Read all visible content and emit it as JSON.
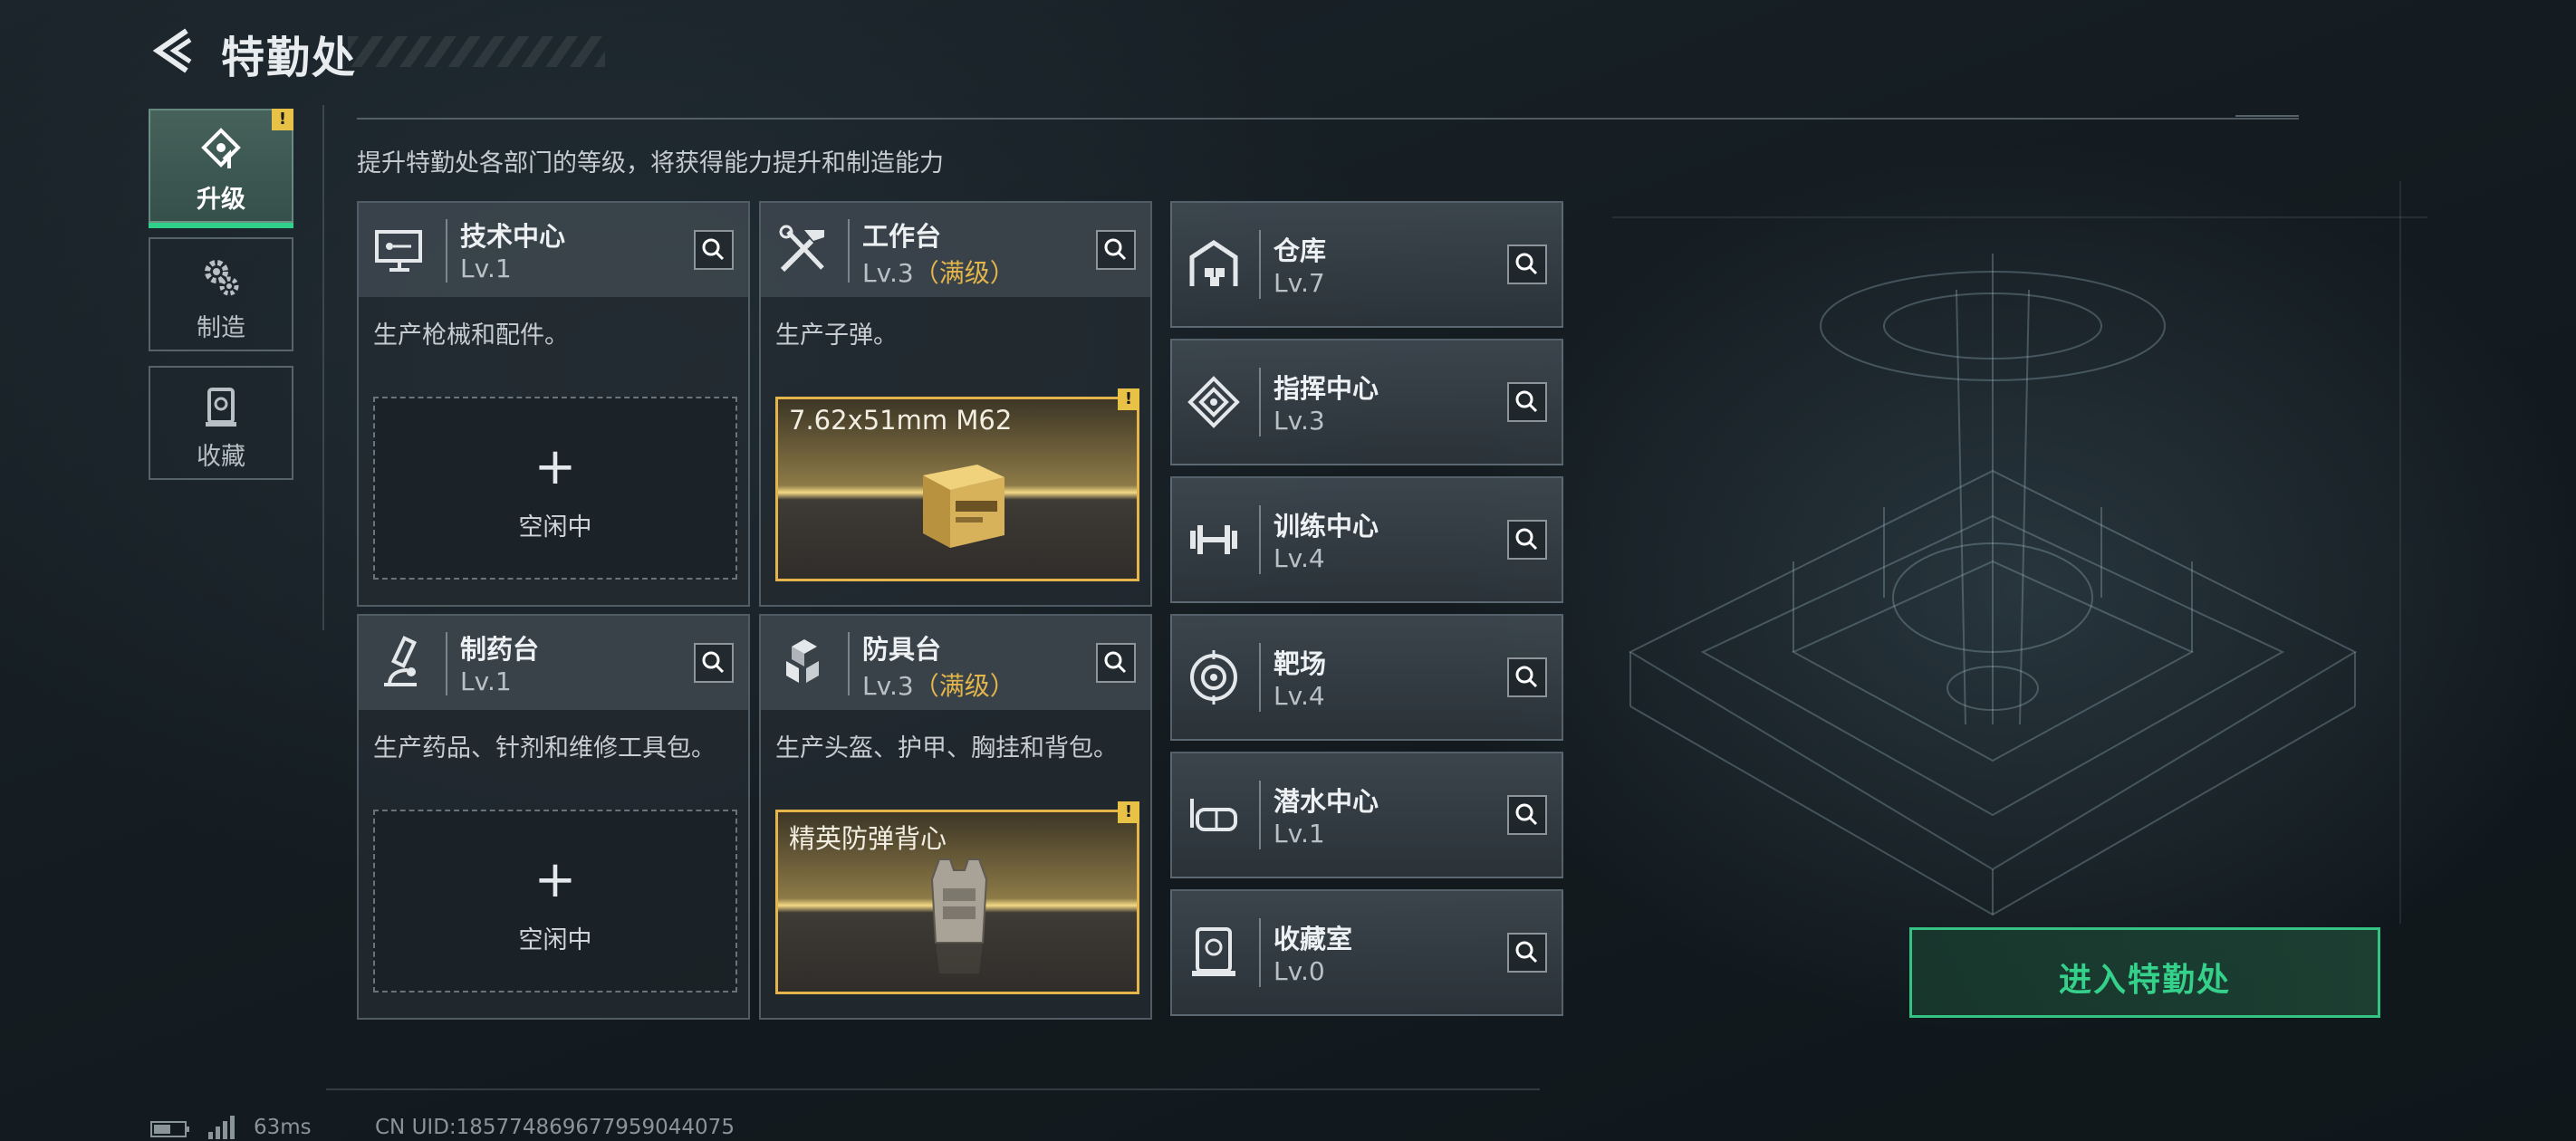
{
  "header": {
    "title": "特勤处"
  },
  "nav": [
    {
      "label": "升级",
      "icon": "upgrade-icon",
      "active": true,
      "warning": "!"
    },
    {
      "label": "制造",
      "icon": "gears-icon",
      "active": false
    },
    {
      "label": "收藏",
      "icon": "collection-icon",
      "active": false
    }
  ],
  "description": "提升特勤处各部门的等级，将获得能力提升和制造能力",
  "cards": [
    {
      "name": "技术中心",
      "level": "Lv.1",
      "level_suffix": "",
      "icon": "tech-center-icon",
      "desc": "生产枪械和配件。",
      "slot": {
        "type": "empty",
        "label": "空闲中"
      }
    },
    {
      "name": "工作台",
      "level": "Lv.3",
      "level_suffix": "（满级）",
      "icon": "workbench-icon",
      "desc": "生产子弹。",
      "slot": {
        "type": "item",
        "label": "7.62x51mm M62",
        "warning": "!"
      }
    },
    {
      "name": "制药台",
      "level": "Lv.1",
      "level_suffix": "",
      "icon": "pharmacy-icon",
      "desc": "生产药品、针剂和维修工具包。",
      "slot": {
        "type": "empty",
        "label": "空闲中"
      }
    },
    {
      "name": "防具台",
      "level": "Lv.3",
      "level_suffix": "（满级）",
      "icon": "armor-bench-icon",
      "desc": "生产头盔、护甲、胸挂和背包。",
      "slot": {
        "type": "item",
        "label": "精英防弹背心",
        "warning": "!"
      }
    }
  ],
  "facilities": [
    {
      "name": "仓库",
      "level": "Lv.7",
      "icon": "warehouse-icon"
    },
    {
      "name": "指挥中心",
      "level": "Lv.3",
      "icon": "command-center-icon"
    },
    {
      "name": "训练中心",
      "level": "Lv.4",
      "icon": "training-center-icon"
    },
    {
      "name": "靶场",
      "level": "Lv.4",
      "icon": "shooting-range-icon"
    },
    {
      "name": "潜水中心",
      "level": "Lv.1",
      "icon": "diving-center-icon"
    },
    {
      "name": "收藏室",
      "level": "Lv.0",
      "icon": "collection-room-icon"
    }
  ],
  "enter_button": "进入特勤处",
  "status_bar": {
    "ping": "63ms",
    "uid": "CN UID:1857748696779590440​75"
  },
  "colors": {
    "accent_green": "#35c384",
    "max_level_gold": "#e3b54a",
    "warning_yellow": "#e7c247"
  }
}
